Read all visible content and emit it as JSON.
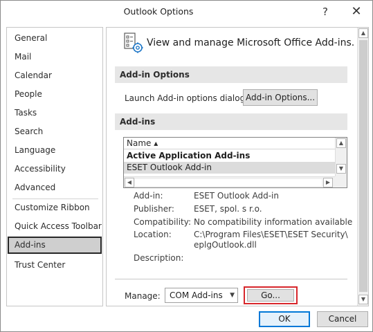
{
  "window": {
    "title": "Outlook Options",
    "help_glyph": "?",
    "close_glyph": "✕"
  },
  "nav": {
    "items": [
      {
        "label": "General"
      },
      {
        "label": "Mail"
      },
      {
        "label": "Calendar"
      },
      {
        "label": "People"
      },
      {
        "label": "Tasks"
      },
      {
        "label": "Search"
      },
      {
        "label": "Language"
      },
      {
        "label": "Accessibility"
      },
      {
        "label": "Advanced"
      },
      {
        "label": "Customize Ribbon"
      },
      {
        "label": "Quick Access Toolbar"
      },
      {
        "label": "Add-ins"
      },
      {
        "label": "Trust Center"
      }
    ],
    "selected": "Add-ins"
  },
  "main": {
    "header": "View and manage Microsoft Office Add-ins.",
    "addin_options": {
      "section_title": "Add-in Options",
      "launch_label": "Launch Add-in options dialog:",
      "button_label": "Add-in Options..."
    },
    "addins": {
      "section_title": "Add-ins",
      "column_header": "Name ▴",
      "group_row": "Active Application Add-ins",
      "selected_row": "ESET Outlook Add-in",
      "details": [
        {
          "key": "Add-in:",
          "value": "ESET Outlook Add-in"
        },
        {
          "key": "Publisher:",
          "value": "ESET, spol. s r.o."
        },
        {
          "key": "Compatibility:",
          "value": "No compatibility information available"
        },
        {
          "key": "Location:",
          "value": "C:\\Program Files\\ESET\\ESET Security\\",
          "value2": "eplgOutlook.dll"
        },
        {
          "key": "Description:",
          "value": ""
        }
      ]
    },
    "manage": {
      "label": "Manage:",
      "selected_option": "COM Add-ins",
      "go_label": "Go..."
    }
  },
  "footer": {
    "ok_label": "OK",
    "cancel_label": "Cancel"
  },
  "colors": {
    "highlight_border": "#d7262b",
    "default_button_border": "#0078d7",
    "selected_nav_bg": "#cfcfcf"
  }
}
